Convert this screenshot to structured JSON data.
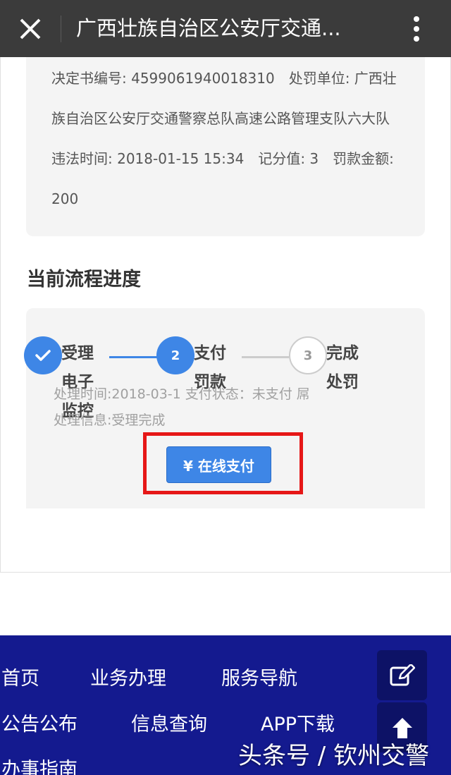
{
  "topbar": {
    "title": "广西壮族自治区公安厅交通...",
    "close_icon": "close-icon",
    "more_icon": "more-vertical-icon"
  },
  "info": {
    "text": "决定书编号: 4599061940018310　处罚单位: 广西壮族自治区公安厅交通警察总队高速公路管理支队六大队　违法时间: 2018-01-15 15:34　记分值: 3　罚款金额: 200"
  },
  "progress": {
    "title": "当前流程进度",
    "steps": [
      {
        "label": "受理电子监控",
        "marker": "check-icon",
        "state": "done"
      },
      {
        "label": "支付罚款",
        "marker": "2",
        "state": "active"
      },
      {
        "label": "完成处罚",
        "marker": "3",
        "state": "todo"
      }
    ],
    "detail_line1": "处理时间:2018-03-1 支付状态：未支付 屌",
    "detail_line2": "处理信息:受理完成",
    "pay_button": "¥ 在线支付"
  },
  "footer": {
    "nav": [
      "首页",
      "业务办理",
      "服务导航",
      "公告公布",
      "信息查询",
      "APP下载",
      "办事指南"
    ],
    "edit_icon": "edit-icon",
    "top_icon": "arrow-up-icon"
  },
  "watermark": "头条号 / 钦州交警",
  "colors": {
    "topbar": "#3b3b3b",
    "accent": "#3e86e6",
    "highlight": "#e61717",
    "footer": "#141a8f"
  }
}
